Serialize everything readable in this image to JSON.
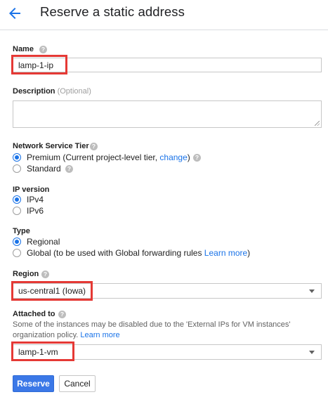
{
  "header": {
    "title": "Reserve a static address"
  },
  "name": {
    "label": "Name",
    "value": "lamp-1-ip"
  },
  "description": {
    "label": "Description",
    "optional": "(Optional)",
    "value": ""
  },
  "tier": {
    "label": "Network Service Tier",
    "premium_label": "Premium (Current project-level tier, ",
    "premium_link": "change",
    "premium_suffix": ")",
    "standard_label": "Standard",
    "selected": "Premium"
  },
  "ip_version": {
    "label": "IP version",
    "options": [
      "IPv4",
      "IPv6"
    ],
    "selected": "IPv4"
  },
  "type": {
    "label": "Type",
    "regional_label": "Regional",
    "global_label": "Global (to be used with Global forwarding rules ",
    "global_link": "Learn more",
    "global_suffix": ")",
    "selected": "Regional"
  },
  "region": {
    "label": "Region",
    "value": "us-central1 (Iowa)"
  },
  "attached": {
    "label": "Attached to",
    "note_line1": "Some of the instances may be disabled due to the 'External IPs for VM instances'",
    "note_line2": "organization policy. ",
    "note_link": "Learn more",
    "value": "lamp-1-vm"
  },
  "buttons": {
    "reserve": "Reserve",
    "cancel": "Cancel"
  },
  "colors": {
    "accent": "#1a73e8",
    "primary_button": "#3b78e7",
    "highlight_box": "#e53935"
  },
  "icons": {
    "back": "arrow-back-icon",
    "help": "help-icon",
    "dropdown": "caret-down-icon"
  }
}
